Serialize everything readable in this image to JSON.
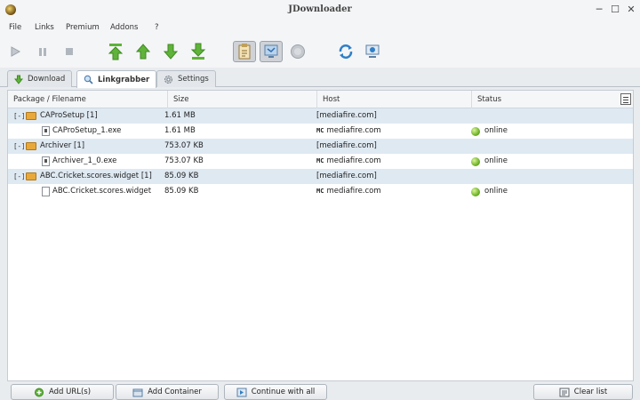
{
  "window": {
    "title": "JDownloader",
    "minimize_glyph": "─",
    "maximize_glyph": "☐",
    "close_glyph": "✕"
  },
  "menu": [
    "File",
    "Links",
    "Premium",
    "Addons",
    "?"
  ],
  "toolbar": {
    "icons": [
      "play-icon",
      "pause-icon",
      "stop-icon",
      "move-top-icon",
      "move-up-icon",
      "move-down-icon",
      "move-bottom-icon",
      "clipboard-observer-icon",
      "auto-reconnect-icon",
      "premium-icon",
      "reconnect-icon",
      "update-icon"
    ],
    "accent_green": "#5fb33a",
    "accent_blue": "#2f7fc8"
  },
  "tabs": [
    {
      "label": "Download",
      "icon": "download-arrow-icon",
      "active": false
    },
    {
      "label": "Linkgrabber",
      "icon": "linkgrabber-icon",
      "active": true
    },
    {
      "label": "Settings",
      "icon": "gear-icon",
      "active": false
    }
  ],
  "table": {
    "columns": [
      "Package / Filename",
      "Size",
      "Host",
      "Status"
    ],
    "packages": [
      {
        "toggle": "[-]",
        "name": "CAProSetup [1]",
        "size": "1.61 MB",
        "host": "[mediafire.com]",
        "files": [
          {
            "name": "CAProSetup_1.exe",
            "size": "1.61 MB",
            "host_icon": "MC",
            "host": "mediafire.com",
            "status": "online"
          }
        ]
      },
      {
        "toggle": "[-]",
        "name": "Archiver [1]",
        "size": "753.07 KB",
        "host": "[mediafire.com]",
        "files": [
          {
            "name": "Archiver_1_0.exe",
            "size": "753.07 KB",
            "host_icon": "MC",
            "host": "mediafire.com",
            "status": "online"
          }
        ]
      },
      {
        "toggle": "[-]",
        "name": "ABC.Cricket.scores.widget [1]",
        "size": "85.09 KB",
        "host": "[mediafire.com]",
        "files": [
          {
            "name": "ABC.Cricket.scores.widget",
            "size": "85.09 KB",
            "host_icon": "MC",
            "host": "mediafire.com",
            "status": "online"
          }
        ]
      }
    ]
  },
  "bottom": {
    "add_urls": "Add URL(s)",
    "add_container": "Add Container",
    "continue_all": "Continue with all",
    "clear_list": "Clear list"
  }
}
